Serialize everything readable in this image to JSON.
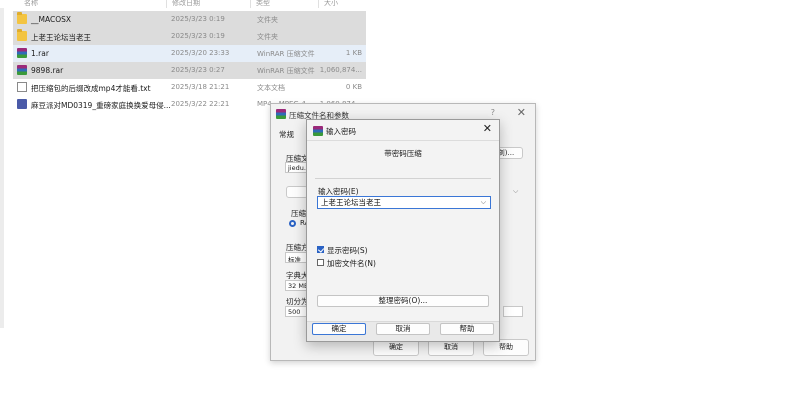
{
  "file_list": {
    "headers": {
      "name": "名称",
      "date": "修改日期",
      "type": "类型",
      "size": "大小"
    },
    "rows": [
      {
        "icon": "folder-icon",
        "name": "__MACOSX",
        "date": "2025/3/23 0:19",
        "type": "文件夹",
        "size": ""
      },
      {
        "icon": "folder-icon",
        "name": "上老王论坛当老王",
        "date": "2025/3/23 0:19",
        "type": "文件夹",
        "size": ""
      },
      {
        "icon": "rar-icon",
        "name": "1.rar",
        "date": "2025/3/20 23:33",
        "type": "WinRAR 压缩文件",
        "size": "1 KB"
      },
      {
        "icon": "rar-icon",
        "name": "9898.rar",
        "date": "2025/3/23 0:27",
        "type": "WinRAR 压缩文件",
        "size": "1,060,874..."
      },
      {
        "icon": "text-file-icon",
        "name": "把压缩包的后缀改成mp4才能看.txt",
        "date": "2025/3/18 21:21",
        "type": "文本文档",
        "size": "0 KB"
      },
      {
        "icon": "video-file-icon",
        "name": "麻豆派对MD0319_重磅家庭换换爱母侵...",
        "date": "2025/3/22 22:21",
        "type": "MP4 - MPEG-4",
        "size": "1,060,874..."
      }
    ]
  },
  "archive_dialog": {
    "title": "压缩文件名和参数",
    "help": "?",
    "close": "✕",
    "tab_general": "常规",
    "archive_label": "压缩文",
    "archive_value": "jiedu.r",
    "browse_button": "浏)...",
    "format_label": "压缩",
    "format_option": "RA",
    "method_label": "压缩方",
    "method_value": "标准",
    "dict_label": "字典大",
    "dict_value": "32 MB",
    "split_label": "切分为",
    "split_value": "500",
    "ok_button": "确定",
    "cancel_button": "取消",
    "help_button": "帮助"
  },
  "password_dialog": {
    "title": "输入密码",
    "close": "✕",
    "group_caption": "带密码压缩",
    "password_label": "输入密码(E)",
    "password_value": "上老王论坛当老王",
    "show_password_label": "显示密码(S)",
    "show_password_checked": true,
    "encrypt_names_label": "加密文件名(N)",
    "encrypt_names_checked": false,
    "organize_button": "整理密码(O)...",
    "ok_button": "确定",
    "cancel_button": "取消",
    "help_button": "帮助"
  },
  "colors": {
    "accent": "#2a62c4",
    "selection": "#dcdcdc",
    "hover": "#e6eef8",
    "dialog_bg": "#f3f3f3"
  }
}
